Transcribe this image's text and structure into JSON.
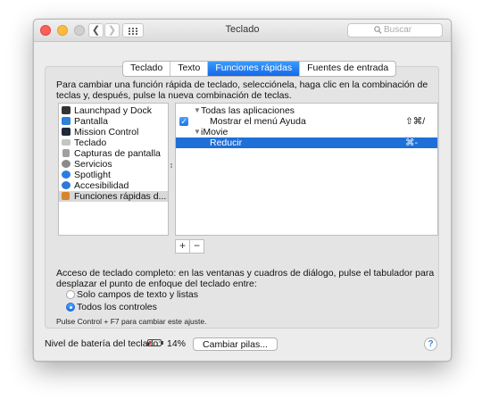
{
  "window": {
    "title": "Teclado",
    "search_placeholder": "Buscar",
    "back_glyph": "❮",
    "forward_glyph": "❯"
  },
  "tabs": [
    {
      "label": "Teclado",
      "selected": false
    },
    {
      "label": "Texto",
      "selected": false
    },
    {
      "label": "Funciones rápidas",
      "selected": true
    },
    {
      "label": "Fuentes de entrada",
      "selected": false
    }
  ],
  "instructions": "Para cambiar una función rápida de teclado, selecciónela, haga clic en la combinación de teclas y, después, pulse la nueva combinación de teclas.",
  "categories": [
    {
      "label": "Launchpad y Dock",
      "icon": "launchpad-dock-icon",
      "color": "#333333"
    },
    {
      "label": "Pantalla",
      "icon": "display-icon",
      "color": "#2d7fd8"
    },
    {
      "label": "Mission Control",
      "icon": "mission-control-icon",
      "color": "#1f2a3a"
    },
    {
      "label": "Teclado",
      "icon": "keyboard-icon",
      "color": "#bdbdbd"
    },
    {
      "label": "Capturas de pantalla",
      "icon": "screenshot-icon",
      "color": "#9a9a9a"
    },
    {
      "label": "Servicios",
      "icon": "gear-icon",
      "color": "#8a8a8a"
    },
    {
      "label": "Spotlight",
      "icon": "spotlight-icon",
      "color": "#2a7de1"
    },
    {
      "label": "Accesibilidad",
      "icon": "accessibility-icon",
      "color": "#2f78d8"
    },
    {
      "label": "Funciones rápidas d...",
      "icon": "app-shortcuts-icon",
      "color": "#d9852b"
    }
  ],
  "shortcuts": {
    "group1": "Todas las aplicaciones",
    "item1": {
      "label": "Mostrar el menú Ayuda",
      "keys": "⇧⌘/"
    },
    "group2": "iMovie",
    "item2": {
      "label": "Reducir",
      "keys": "⌘-"
    }
  },
  "buttons": {
    "add": "+",
    "remove": "−",
    "change_batteries": "Cambiar pilas...",
    "help": "?"
  },
  "access": {
    "description": "Acceso de teclado completo: en las ventanas y cuadros de diálogo, pulse el tabulador para desplazar el punto de enfoque del teclado entre:",
    "option1": "Solo campos de texto y listas",
    "option2": "Todos los controles",
    "hint": "Pulse Control + F7 para cambiar este ajuste."
  },
  "battery": {
    "label": "Nivel de batería del teclado:",
    "percent": "14%",
    "level": 0.14
  },
  "colors": {
    "accent": "#1e6fd8",
    "battery_low": "#e53b2d"
  }
}
